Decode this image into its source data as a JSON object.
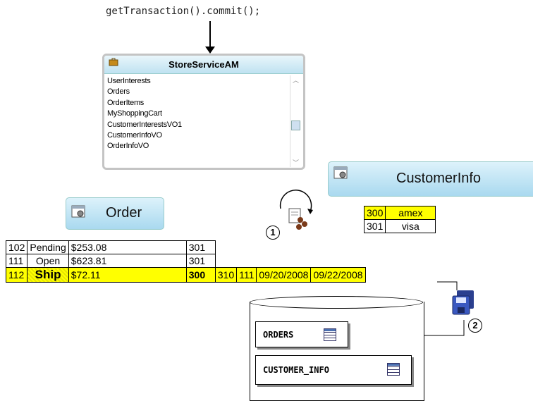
{
  "code": "getTransaction().commit();",
  "am": {
    "title": "StoreServiceAM",
    "items": [
      "UserInterests",
      "Orders",
      "OrderItems",
      "MyShoppingCart",
      "CustomerInterestsVO1",
      "CustomerInfoVO",
      "OrderInfoVO"
    ]
  },
  "customer_info": {
    "title": "CustomerInfo",
    "rows": [
      [
        "300",
        "amex"
      ],
      [
        "301",
        "visa"
      ]
    ]
  },
  "order": {
    "title": "Order",
    "rows": [
      [
        "102",
        "Pending",
        "$253.08",
        "301"
      ],
      [
        "111",
        "Open",
        "$623.81",
        "301"
      ],
      [
        "112",
        "Ship",
        "$72.11",
        "300",
        "310",
        "111",
        "09/20/2008",
        "09/22/2008"
      ]
    ]
  },
  "steps": [
    "1",
    "2"
  ],
  "db_tables": [
    "ORDERS",
    "CUSTOMER_INFO"
  ]
}
